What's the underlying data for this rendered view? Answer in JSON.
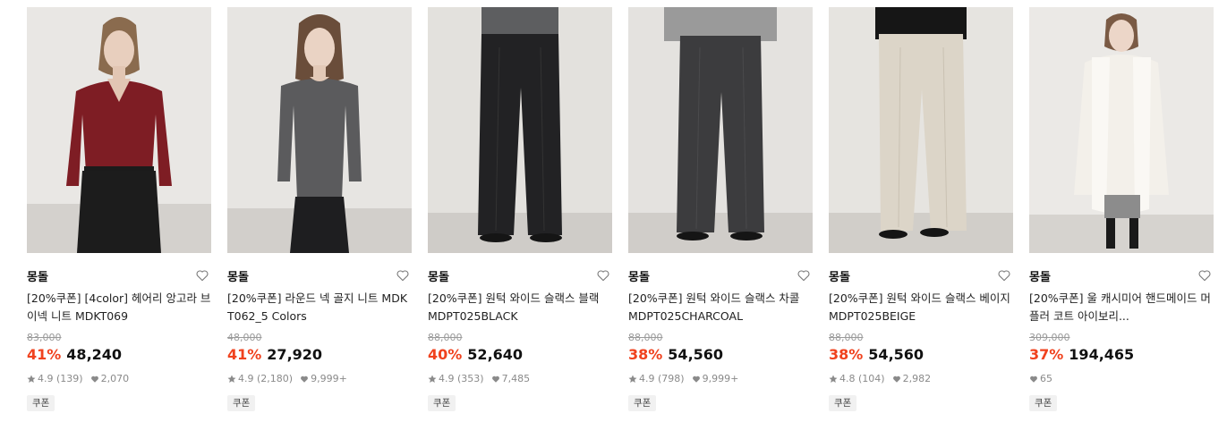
{
  "products": [
    {
      "brand": "몽돌",
      "name": "[20%쿠폰] [4color] 헤어리 앙고라 브이넥 니트 MDKT069",
      "original_price": "83,000",
      "discount": "41%",
      "price": "48,240",
      "rating": "4.9",
      "reviews": "(139)",
      "likes": "2,070",
      "badge": "쿠폰",
      "image": "model-burgundy-sweater-black-skirt"
    },
    {
      "brand": "몽돌",
      "name": "[20%쿠폰] 라운드 넥 골지 니트 MDKT062_5 Colors",
      "original_price": "48,000",
      "discount": "41%",
      "price": "27,920",
      "rating": "4.9",
      "reviews": "(2,180)",
      "likes": "9,999+",
      "badge": "쿠폰",
      "image": "model-gray-rib-knit"
    },
    {
      "brand": "몽돌",
      "name": "[20%쿠폰] 원턱 와이드 슬랙스 블랙 MDPT025BLACK",
      "original_price": "88,000",
      "discount": "40%",
      "price": "52,640",
      "rating": "4.9",
      "reviews": "(353)",
      "likes": "7,485",
      "badge": "쿠폰",
      "image": "black-wide-slacks"
    },
    {
      "brand": "몽돌",
      "name": "[20%쿠폰] 원턱 와이드 슬랙스 차콜 MDPT025CHARCOAL",
      "original_price": "88,000",
      "discount": "38%",
      "price": "54,560",
      "rating": "4.9",
      "reviews": "(798)",
      "likes": "9,999+",
      "badge": "쿠폰",
      "image": "charcoal-wide-slacks"
    },
    {
      "brand": "몽돌",
      "name": "[20%쿠폰] 원턱 와이드 슬랙스 베이지 MDPT025BEIGE",
      "original_price": "88,000",
      "discount": "38%",
      "price": "54,560",
      "rating": "4.8",
      "reviews": "(104)",
      "likes": "2,982",
      "badge": "쿠폰",
      "image": "beige-wide-slacks"
    },
    {
      "brand": "몽돌",
      "name": "[20%쿠폰] 울 캐시미어 핸드메이드 머플러 코트 아이보리...",
      "original_price": "309,000",
      "discount": "37%",
      "price": "194,465",
      "rating": "",
      "reviews": "",
      "likes": "65",
      "badge": "쿠폰",
      "image": "model-ivory-muffler-coat"
    }
  ],
  "icons": {
    "wishlist": "heart-outline-icon",
    "rating": "star-icon",
    "likes": "heart-filled-icon"
  },
  "colors": {
    "discount": "#f0421e",
    "meta": "#8a8a8a",
    "badge_bg": "#f1f1f1"
  }
}
